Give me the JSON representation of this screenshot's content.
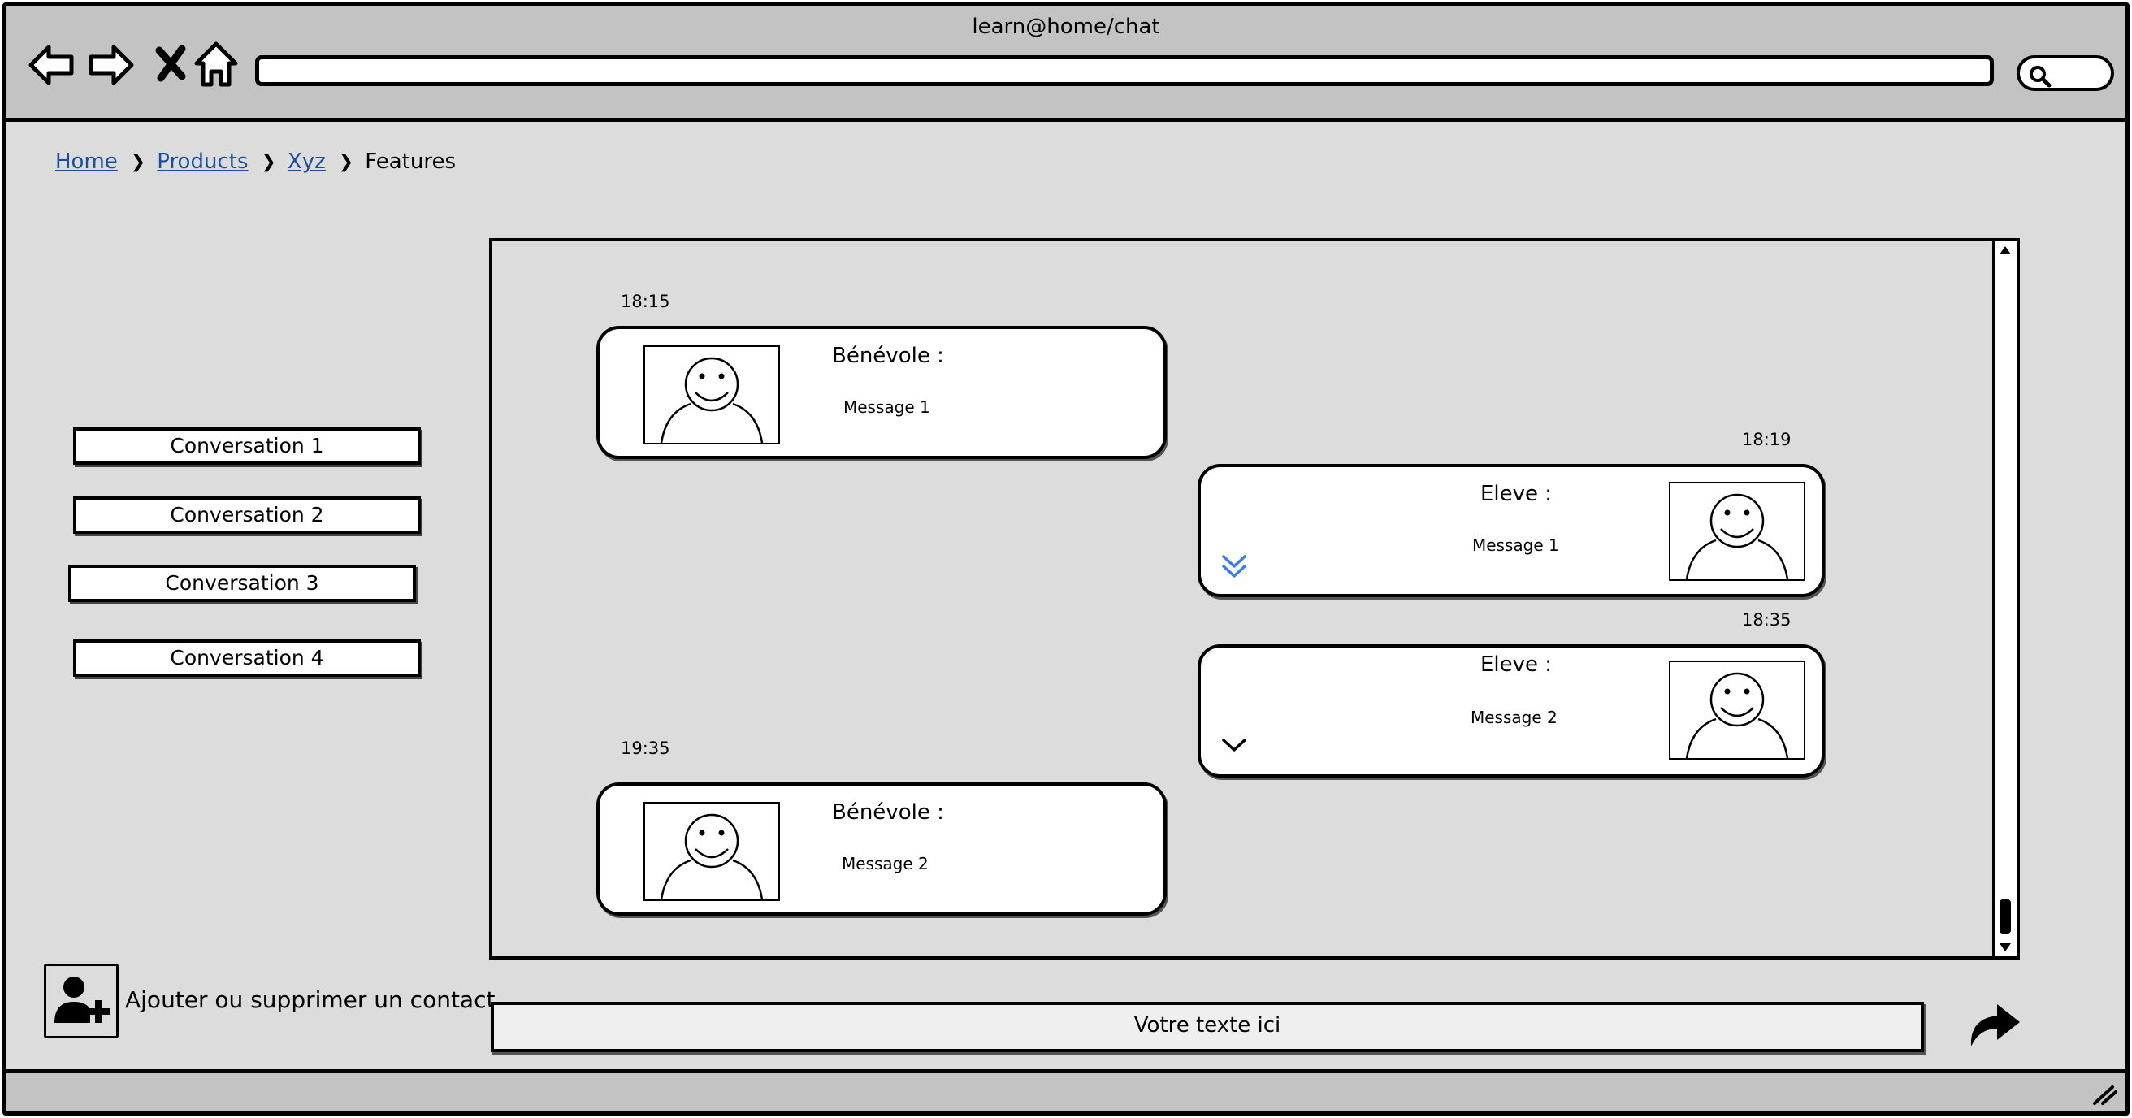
{
  "window": {
    "title": "learn@home/chat"
  },
  "toolbar": {
    "back_icon": "arrow-left-icon",
    "forward_icon": "arrow-right-icon",
    "stop_icon": "close-icon",
    "home_icon": "home-icon",
    "address_value": "",
    "search_icon": "search-icon"
  },
  "breadcrumb": {
    "items": [
      {
        "label": "Home",
        "link": true
      },
      {
        "label": "Products",
        "link": true
      },
      {
        "label": "Xyz",
        "link": true
      },
      {
        "label": "Features",
        "link": false
      }
    ]
  },
  "sidebar": {
    "conversations": [
      {
        "label": "Conversation 1"
      },
      {
        "label": "Conversation 2"
      },
      {
        "label": "Conversation 3"
      },
      {
        "label": "Conversation 4"
      }
    ],
    "add_contact_label": "Ajouter ou supprimer un contact",
    "add_contact_icon": "user-plus-icon"
  },
  "chat": {
    "messages": [
      {
        "time": "18:15",
        "sender": "Bénévole :",
        "text": "Message 1",
        "side": "left"
      },
      {
        "time": "18:19",
        "sender": "Eleve :",
        "text": "Message 1",
        "side": "right",
        "expand_icon": "double-chevron-down-icon"
      },
      {
        "time": "18:35",
        "sender": "Eleve :",
        "text": "Message 2",
        "side": "right",
        "expand_icon": "chevron-down-icon"
      },
      {
        "time": "19:35",
        "sender": "Bénévole :",
        "text": "Message 2",
        "side": "left"
      }
    ]
  },
  "composer": {
    "placeholder": "Votre texte ici",
    "send_icon": "send-icon"
  },
  "colors": {
    "link": "#1a4fa0",
    "accent_chevron": "#3b7ee8",
    "chrome": "#c3c3c3",
    "background": "#dcdcdc"
  }
}
